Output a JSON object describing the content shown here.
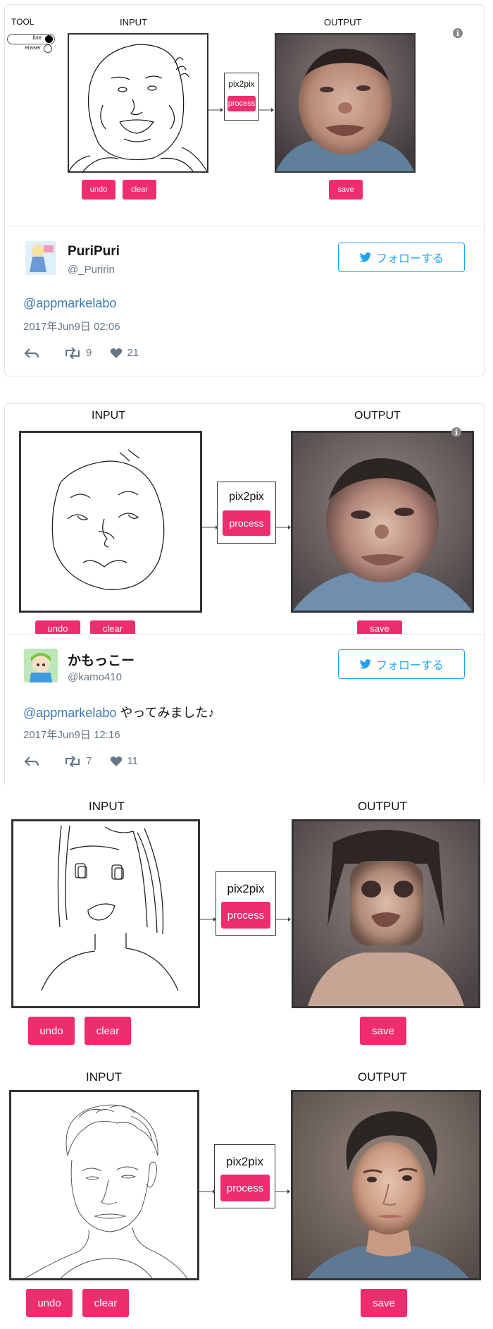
{
  "panel1": {
    "tool_label": "TOOL",
    "tool_line": "line",
    "tool_eraser": "eraser",
    "input_label": "INPUT",
    "output_label": "OUTPUT",
    "model_label": "pix2pix",
    "process_label": "process",
    "undo_label": "undo",
    "clear_label": "clear",
    "save_label": "save"
  },
  "tweet1": {
    "name": "PuriPuri",
    "handle": "@_Puririn",
    "follow_label": "フォローする",
    "mention": "@appmarkelabo",
    "text": "",
    "date": "2017年Jun9日 02:06",
    "retweets": "9",
    "likes": "21"
  },
  "panel2": {
    "input_label": "INPUT",
    "output_label": "OUTPUT",
    "model_label": "pix2pix",
    "process_label": "process",
    "undo_label": "undo",
    "clear_label": "clear",
    "save_label": "save"
  },
  "tweet2": {
    "name": "かもっこー",
    "handle": "@kamo410",
    "follow_label": "フォローする",
    "mention": "@appmarkelabo",
    "text": " やってみました♪",
    "date": "2017年Jun9日 12:16",
    "retweets": "7",
    "likes": "11"
  },
  "panel3": {
    "input_label": "INPUT",
    "output_label": "OUTPUT",
    "model_label": "pix2pix",
    "process_label": "process",
    "undo_label": "undo",
    "clear_label": "clear",
    "save_label": "save"
  },
  "panel4": {
    "input_label": "INPUT",
    "output_label": "OUTPUT",
    "model_label": "pix2pix",
    "process_label": "process",
    "undo_label": "undo",
    "clear_label": "clear",
    "save_label": "save"
  }
}
